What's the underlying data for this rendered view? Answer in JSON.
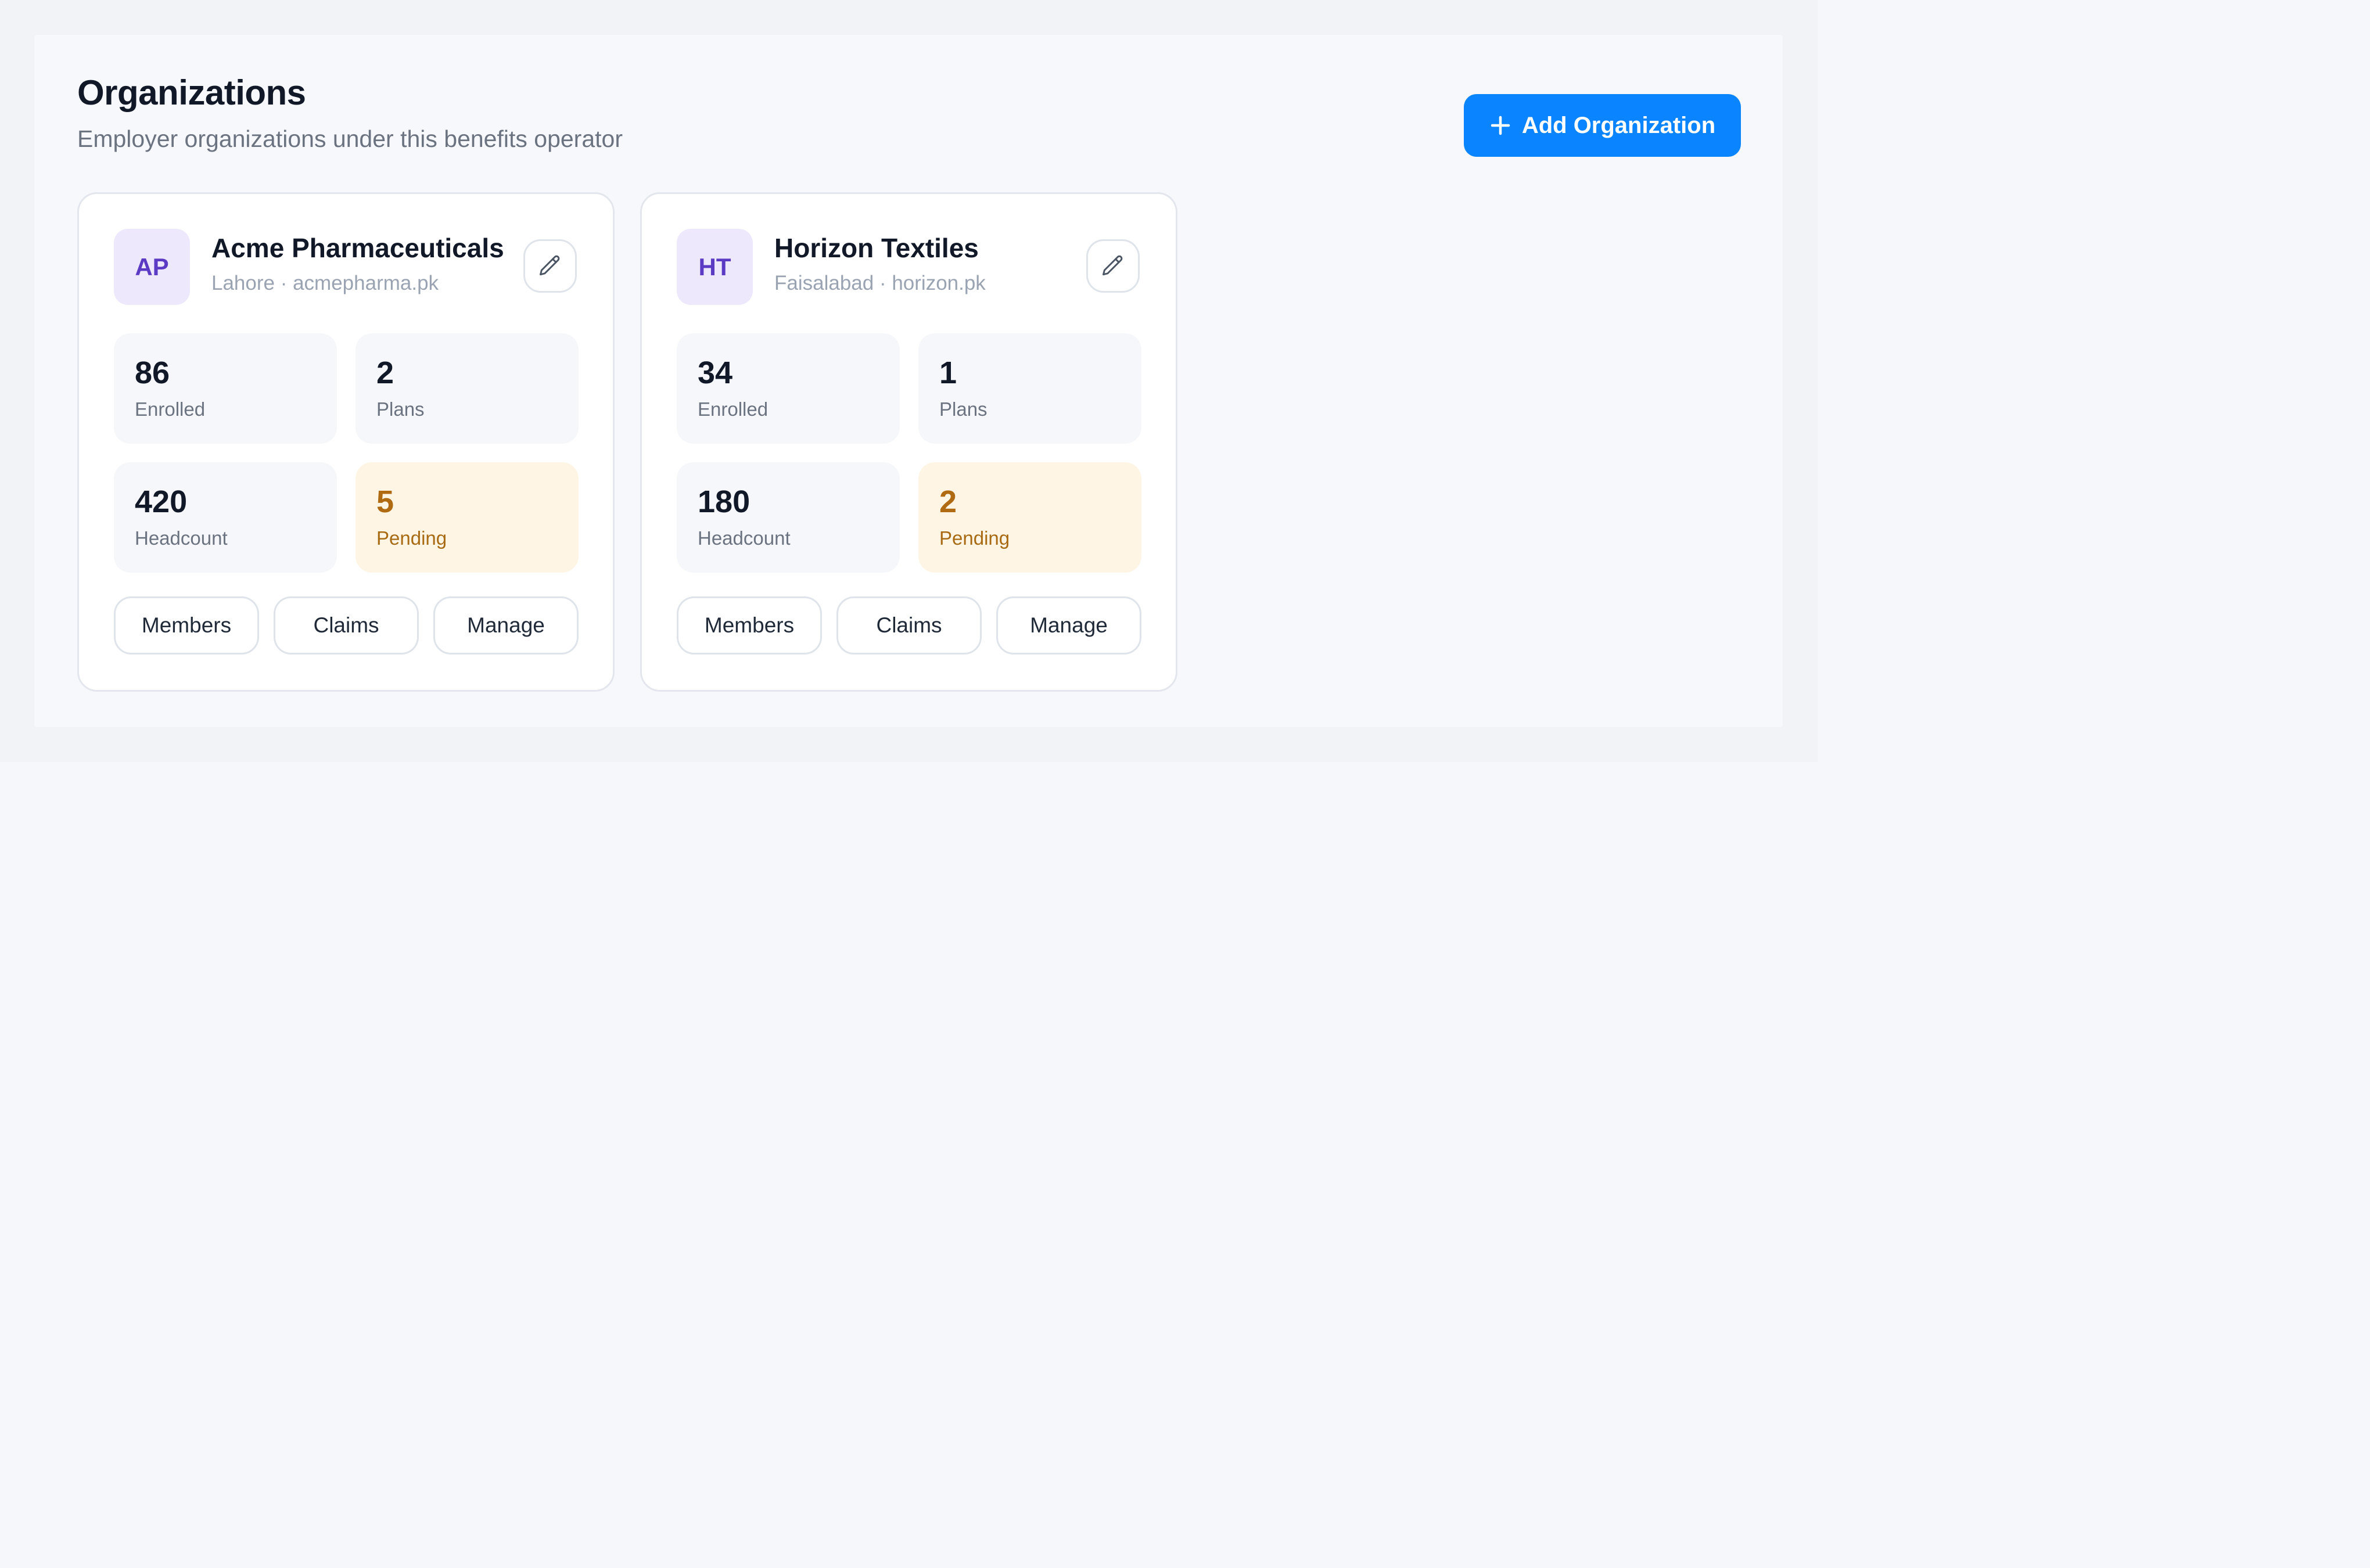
{
  "header": {
    "title": "Organizations",
    "subtitle": "Employer organizations under this benefits operator",
    "add_button_label": "Add Organization"
  },
  "colors": {
    "primary": "#0a84ff",
    "avatar_bg": "#ede8fc",
    "avatar_text": "#5b3bc4",
    "pending_bg": "#fef5e5",
    "pending_text": "#b06a12"
  },
  "organizations": [
    {
      "initials": "AP",
      "name": "Acme Pharmaceuticals",
      "meta": "Lahore · acmepharma.pk",
      "stats": [
        {
          "value": "86",
          "label": "Enrolled"
        },
        {
          "value": "2",
          "label": "Plans"
        },
        {
          "value": "420",
          "label": "Headcount"
        },
        {
          "value": "5",
          "label": "Pending"
        }
      ],
      "actions": [
        "Members",
        "Claims",
        "Manage"
      ]
    },
    {
      "initials": "HT",
      "name": "Horizon Textiles",
      "meta": "Faisalabad · horizon.pk",
      "stats": [
        {
          "value": "34",
          "label": "Enrolled"
        },
        {
          "value": "1",
          "label": "Plans"
        },
        {
          "value": "180",
          "label": "Headcount"
        },
        {
          "value": "2",
          "label": "Pending"
        }
      ],
      "actions": [
        "Members",
        "Claims",
        "Manage"
      ]
    }
  ]
}
